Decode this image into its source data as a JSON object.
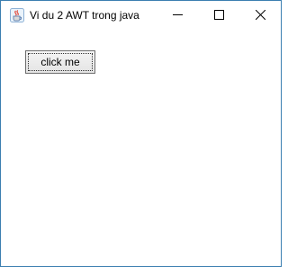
{
  "window": {
    "title": "Vi du 2 AWT trong java",
    "app_icon": "java-cup-icon",
    "border_color": "#3c7fb1",
    "controls": {
      "minimize": "minimize-icon",
      "maximize": "maximize-icon",
      "close": "close-icon"
    }
  },
  "content": {
    "button_label": "click me"
  }
}
